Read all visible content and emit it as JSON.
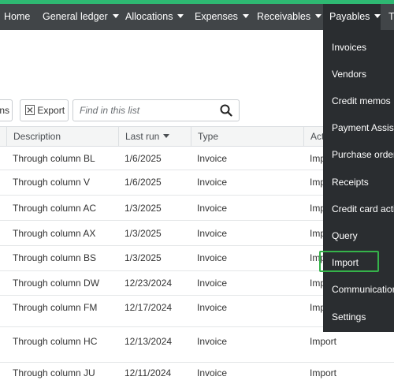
{
  "nav": {
    "items": [
      {
        "label": "Home",
        "caret": false
      },
      {
        "label": "General ledger",
        "caret": true
      },
      {
        "label": "Allocations",
        "caret": true
      },
      {
        "label": "Expenses",
        "caret": true
      },
      {
        "label": "Receivables",
        "caret": true
      },
      {
        "label": "Payables",
        "caret": true,
        "active": true
      },
      {
        "label": "T",
        "caret": false
      }
    ]
  },
  "toolbar": {
    "columns_label": "ns",
    "export_label": "Export",
    "search_placeholder": "Find in this list"
  },
  "table": {
    "headers": [
      "Description",
      "Last run",
      "Type",
      "Act"
    ],
    "sorted_column": "Last run",
    "rows": [
      {
        "description": "Through column BL",
        "last_run": "1/6/2025",
        "type": "Invoice",
        "action": "Imp"
      },
      {
        "description": "Through column V",
        "last_run": "1/6/2025",
        "type": "Invoice",
        "action": "Imp"
      },
      {
        "description": "Through column AC",
        "last_run": "1/3/2025",
        "type": "Invoice",
        "action": "Imp"
      },
      {
        "description": "Through column AX",
        "last_run": "1/3/2025",
        "type": "Invoice",
        "action": "Imp"
      },
      {
        "description": "Through column BS",
        "last_run": "1/3/2025",
        "type": "Invoice",
        "action": "Imp"
      },
      {
        "description": "Through column DW",
        "last_run": "12/23/2024",
        "type": "Invoice",
        "action": "Imp"
      },
      {
        "description": "Through column FM",
        "last_run": "12/17/2024",
        "type": "Invoice",
        "action": "Imp"
      },
      {
        "description": "Through column HC",
        "last_run": "12/13/2024",
        "type": "Invoice",
        "action": "Import"
      },
      {
        "description": "Through column JU",
        "last_run": "12/11/2024",
        "type": "Invoice",
        "action": "Import"
      }
    ]
  },
  "payables_menu": {
    "items": [
      "Invoices",
      "Vendors",
      "Credit memos",
      "Payment Assista",
      "Purchase orders",
      "Receipts",
      "Credit card activ",
      "Query",
      "Import",
      "Communications",
      "Settings"
    ],
    "highlighted": "Import"
  },
  "colors": {
    "topbar": "#414548",
    "accent_stripe": "#2eb872",
    "dropdown_bg": "#2a2d30",
    "highlight_border": "#35b34a"
  }
}
